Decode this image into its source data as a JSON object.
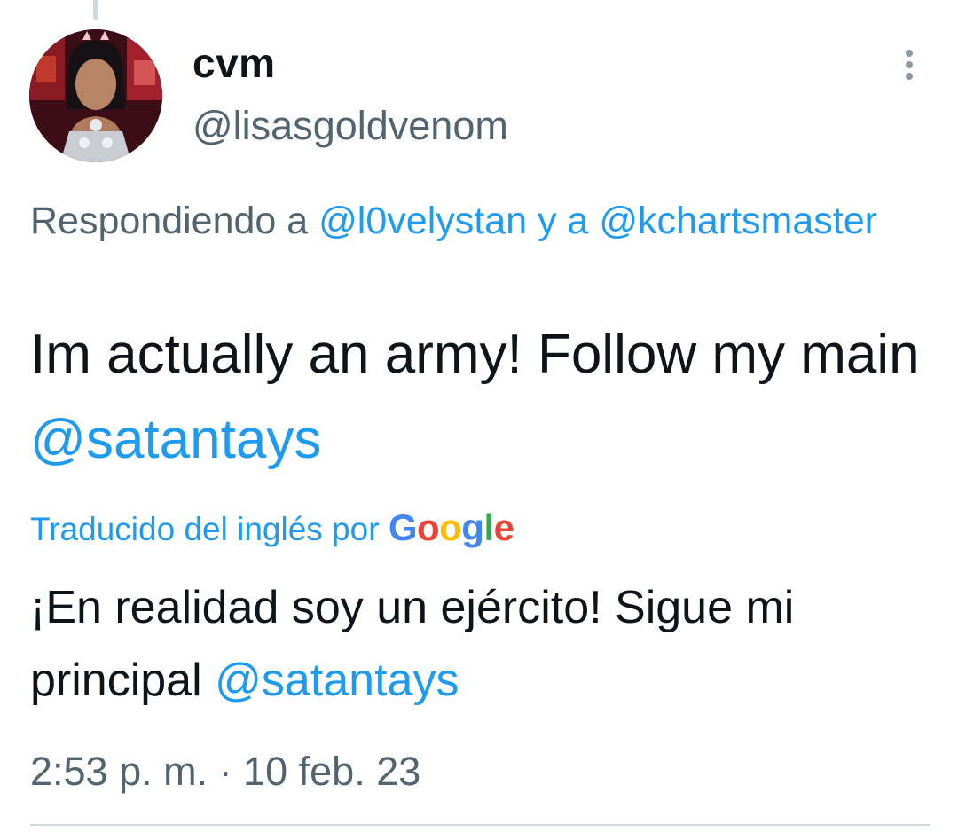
{
  "tweet": {
    "display_name": "cvm",
    "handle": "@lisasgoldvenom",
    "replying_prefix": "Respondiendo a",
    "replying_mention_1": "@l0velystan",
    "replying_joiner": "y a",
    "replying_mention_2": "@kchartsmaster",
    "text_main": "Im actually an army! Follow my main",
    "text_mention": "@satantays",
    "translated_by_label": "Traducido del inglés por",
    "translation_main": "¡En realidad soy un ejército! Sigue mi principal",
    "translation_mention": "@satantays",
    "timestamp": "2:53 p. m. · 10 feb. 23"
  },
  "google_logo": {
    "letters": [
      "G",
      "o",
      "o",
      "g",
      "l",
      "e"
    ],
    "colors": [
      "#4285f4",
      "#ea4335",
      "#fbbc05",
      "#4285f4",
      "#34a853",
      "#ea4335"
    ]
  },
  "icons": {
    "more": "more-vertical-icon"
  },
  "colors": {
    "text": "#0f1419",
    "secondary": "#536471",
    "link": "#1d9bf0",
    "divider": "#cfd9de"
  }
}
